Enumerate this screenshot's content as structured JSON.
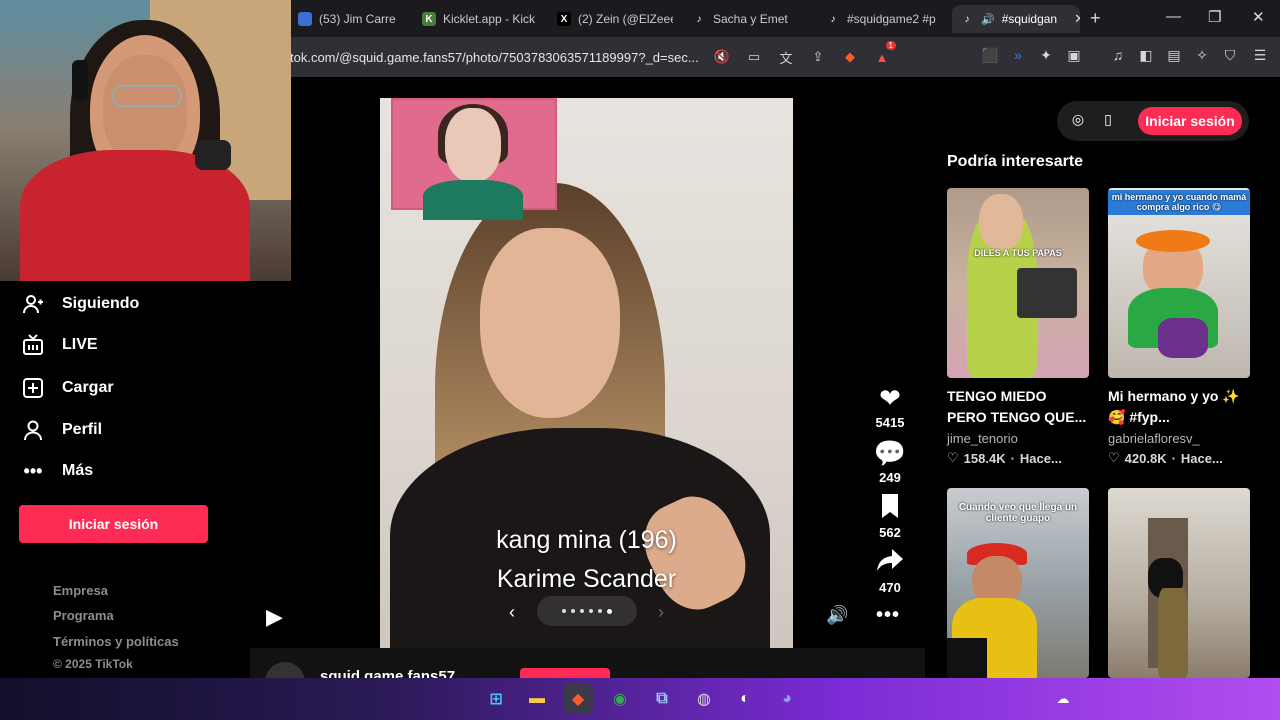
{
  "browser": {
    "tabs": [
      {
        "label": "(53) Jim Carre",
        "icon_color": "#3d6fd1"
      },
      {
        "label": "Kicklet.app - Kick",
        "icon_color": "#4a7d3a"
      },
      {
        "label": "(2) Zein (@ElZeee",
        "icon_color": "#000000"
      },
      {
        "label": "Sacha y Emet",
        "icon_color": "#000000"
      },
      {
        "label": "#squidgame2 #p",
        "icon_color": "#000000"
      },
      {
        "label": "#squidgan",
        "icon_color": "#000000",
        "active": true
      }
    ],
    "url": "tok.com/@squid.game.fans57/photo/7503783063571189997?_d=sec...",
    "shield_badge": "1"
  },
  "sidebar": {
    "items": [
      {
        "label": "Siguiendo",
        "icon": "user-follow-icon"
      },
      {
        "label": "LIVE",
        "icon": "live-tv-icon"
      },
      {
        "label": "Cargar",
        "icon": "upload-plus-icon"
      },
      {
        "label": "Perfil",
        "icon": "profile-icon"
      },
      {
        "label": "Más",
        "icon": "more-dots-icon"
      }
    ],
    "login_label": "Iniciar sesión",
    "footer_links": [
      "Empresa",
      "Programa",
      "Términos y políticas"
    ],
    "copyright": "© 2025 TikTok"
  },
  "post": {
    "caption_line1": "kang mina (196)",
    "caption_line2": "Karime Scander",
    "username": "squid.game.fans57",
    "likes": "5415",
    "comments": "249",
    "saves": "562",
    "shares": "470"
  },
  "header": {
    "login_label": "Iniciar sesión"
  },
  "recommendations": {
    "title": "Podría interesarte",
    "cards": [
      {
        "title": "TENGO MIEDO PERO TENGO QUE...",
        "author": "jime_tenorio",
        "likes": "158.4K",
        "time": "Hace...",
        "thumb_text": "DILES A TUS PAPAS"
      },
      {
        "title": "Mi hermano y yo ✨🥰 #fyp...",
        "author": "gabrielafloresv_",
        "likes": "420.8K",
        "time": "Hace...",
        "thumb_text": "mi hermano y yo cuando mamá compra algo rico 😋"
      },
      {
        "title": "",
        "author": "",
        "likes": "",
        "time": "",
        "thumb_text": "Cuando veo que llega un cliente guapo"
      },
      {
        "title": "",
        "author": "",
        "likes": "",
        "time": "",
        "thumb_text": ""
      }
    ]
  },
  "colors": {
    "accent": "#fe2c55",
    "background": "#000000",
    "muted_text": "#8c8c91"
  }
}
